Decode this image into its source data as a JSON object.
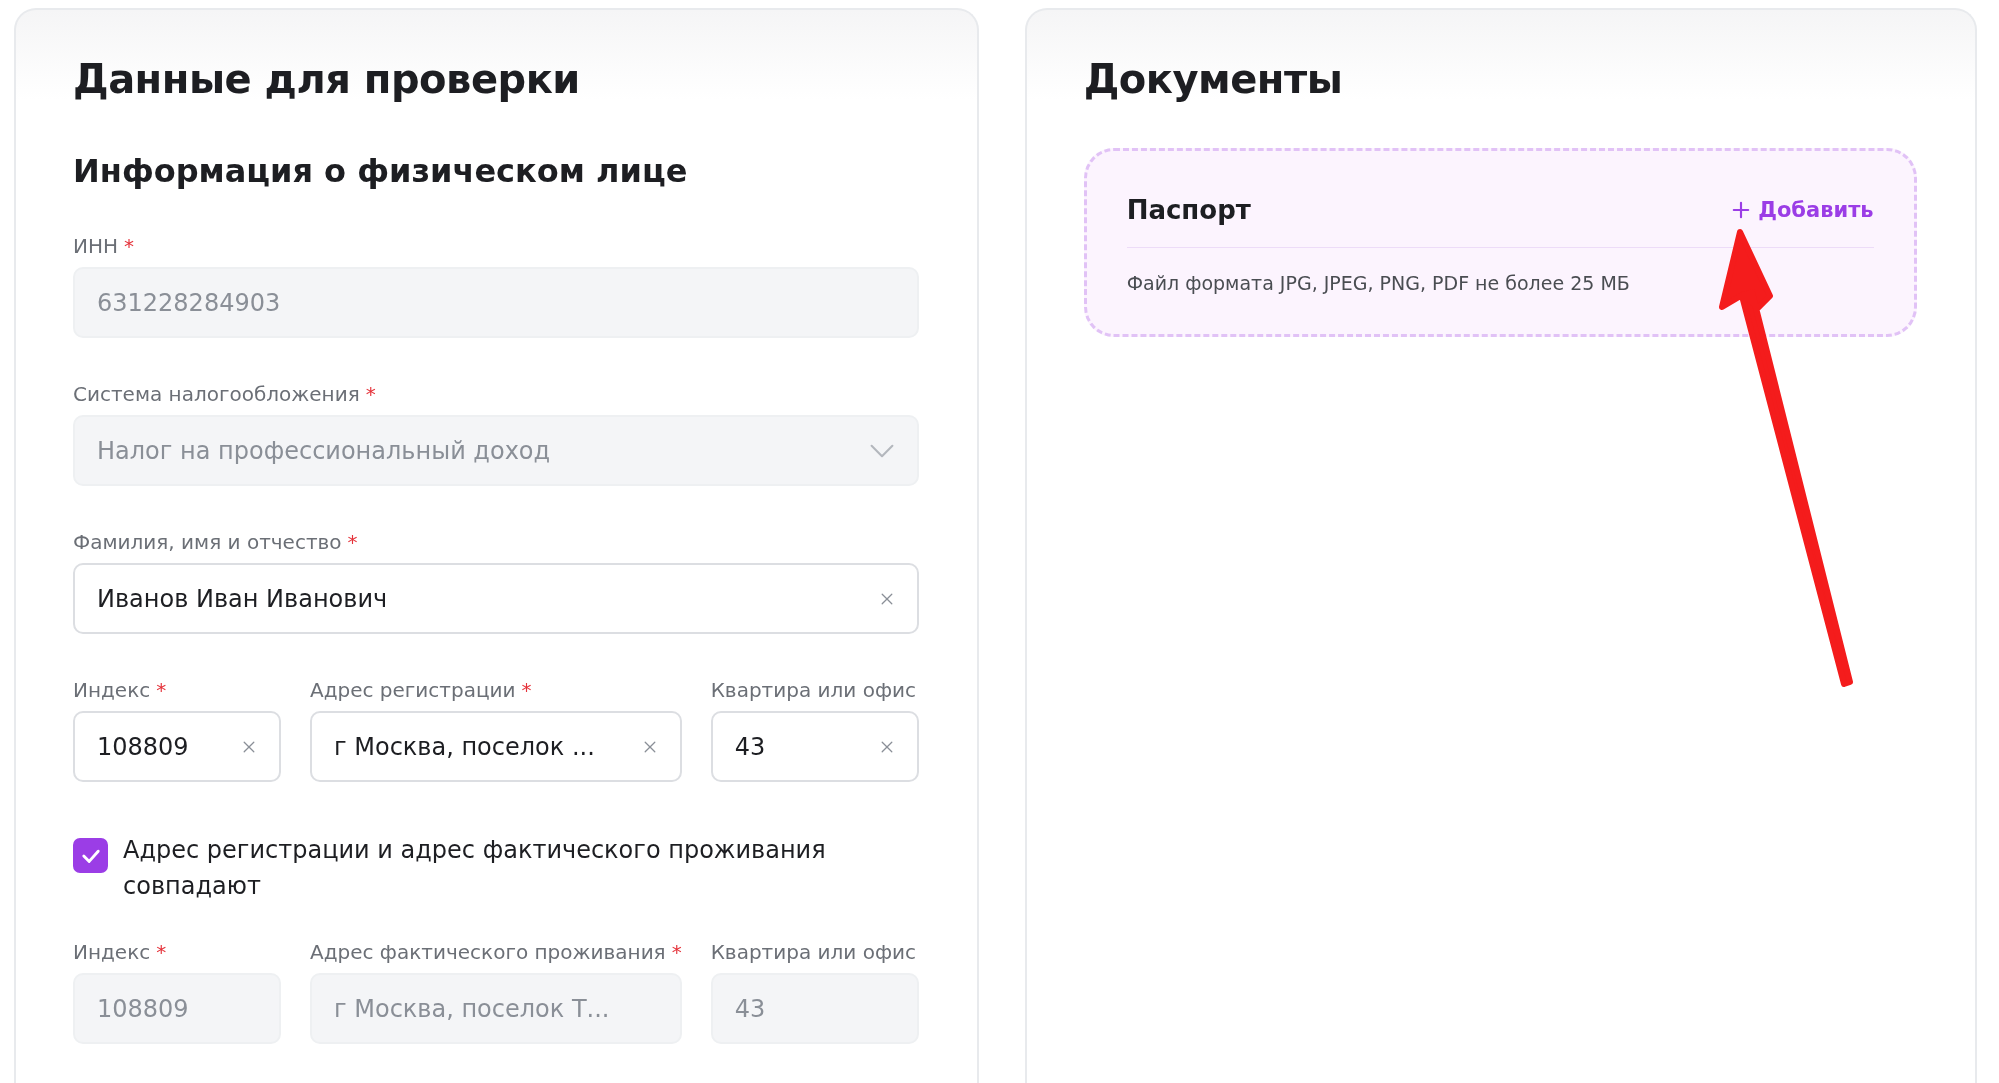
{
  "verification": {
    "title": "Данные для проверки",
    "subtitle": "Информация о физическом лице",
    "rows": [
      {
        "fields": [
          {
            "label": "ИНН",
            "required_mark": "*",
            "value": "631228284903",
            "kind": "text",
            "disabled": true,
            "clearable": false
          }
        ]
      },
      {
        "fields": [
          {
            "label": "Система налогообложения",
            "required_mark": "*",
            "value": "Налог на профессиональный доход",
            "kind": "select",
            "disabled": true,
            "clearable": false
          }
        ]
      },
      {
        "fields": [
          {
            "label": "Фамилия, имя и отчество",
            "required_mark": "*",
            "value": "Иванов Иван Иванович",
            "kind": "text",
            "disabled": false,
            "clearable": true
          }
        ]
      },
      {
        "fields": [
          {
            "label": "Индекс",
            "required_mark": "*",
            "value": "108809",
            "kind": "text",
            "disabled": false,
            "clearable": true
          },
          {
            "label": "Адрес регистрации",
            "required_mark": "*",
            "value": "г Москва, поселок ...",
            "kind": "text",
            "disabled": false,
            "clearable": true
          },
          {
            "label": "Квартира или офис",
            "value": "43",
            "kind": "text",
            "disabled": false,
            "clearable": true
          }
        ]
      },
      {
        "checkbox": {
          "label": "Адрес регистрации и адрес фактического проживания совпадают",
          "checked": true
        }
      },
      {
        "fields": [
          {
            "label": "Индекс",
            "required_mark": "*",
            "value": "108809",
            "kind": "text",
            "disabled": true,
            "clearable": false
          },
          {
            "label": "Адрес фактического проживания",
            "required_mark": "*",
            "value": "г Москва, поселок Т...",
            "kind": "text",
            "disabled": true,
            "clearable": false
          },
          {
            "label": "Квартира или офис",
            "value": "43",
            "kind": "text",
            "disabled": true,
            "clearable": false
          }
        ]
      }
    ]
  },
  "documents": {
    "title": "Документы",
    "items": [
      {
        "name": "Паспорт",
        "action": "Добавить",
        "hint": "Файл формата JPG, JPEG, PNG, PDF не более 25 МБ"
      }
    ]
  }
}
